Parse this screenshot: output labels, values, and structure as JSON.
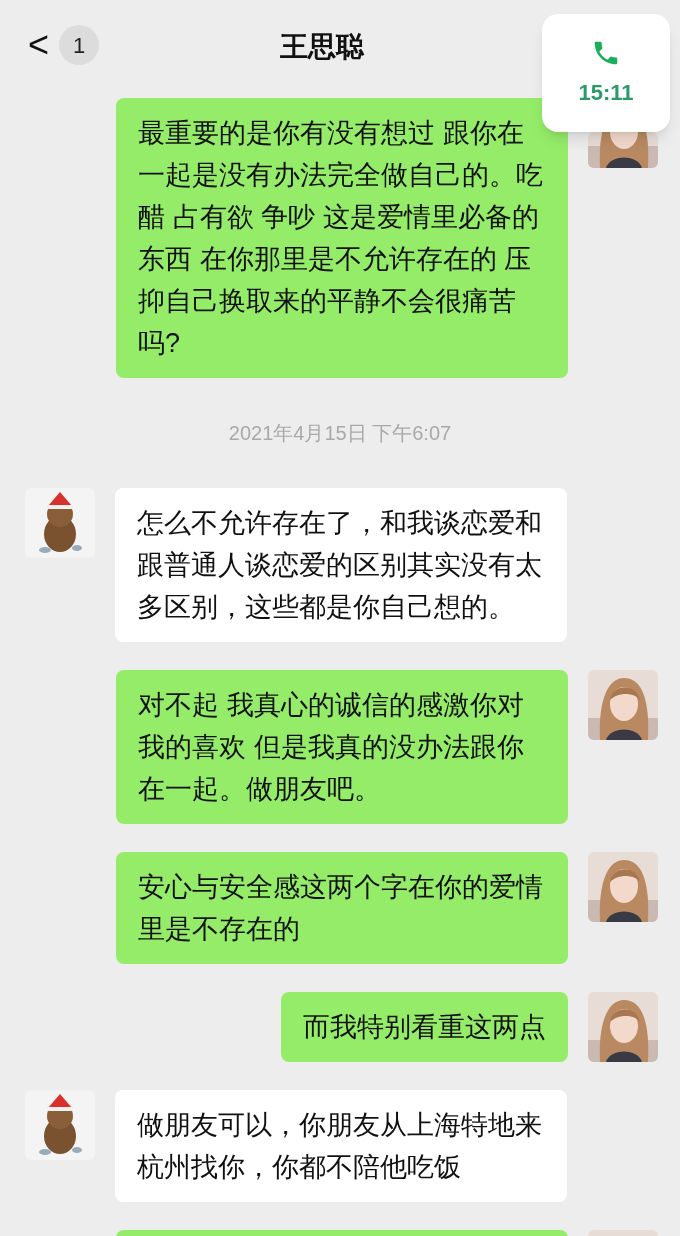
{
  "header": {
    "back_icon": "<",
    "unread_count": "1",
    "title": "王思聪"
  },
  "call_widget": {
    "time": "15:11"
  },
  "messages": [
    {
      "kind": "self",
      "text": "最重要的是你有没有想过 跟你在一起是没有办法完全做自己的。吃醋 占有欲 争吵 这是爱情里必备的东西 在你那里是不允许存在的 压抑自己换取来的平静不会很痛苦吗?"
    },
    {
      "kind": "time",
      "text": "2021年4月15日 下午6:07"
    },
    {
      "kind": "other",
      "text": "怎么不允许存在了，和我谈恋爱和跟普通人谈恋爱的区别其实没有太多区别，这些都是你自己想的。"
    },
    {
      "kind": "self",
      "text": "对不起 我真心的诚信的感激你对我的喜欢 但是我真的没办法跟你在一起。做朋友吧。"
    },
    {
      "kind": "self",
      "text": "安心与安全感这两个字在你的爱情里是不存在的"
    },
    {
      "kind": "self",
      "text": "而我特别看重这两点"
    },
    {
      "kind": "other",
      "text": "做朋友可以，你朋友从上海特地来杭州找你，你都不陪他吃饭"
    },
    {
      "kind": "self"
    }
  ]
}
